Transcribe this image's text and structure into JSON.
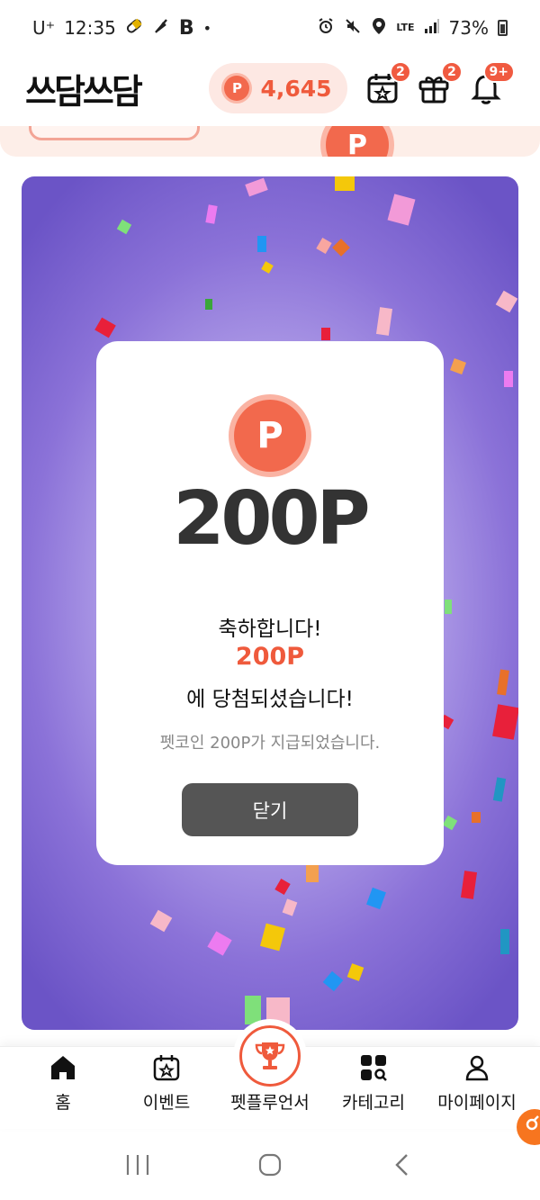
{
  "status_bar": {
    "carrier": "U⁺",
    "time": "12:35",
    "notif_b": "B",
    "dot": "•",
    "network": "LTE",
    "battery": "73%"
  },
  "header": {
    "logo": "쓰담쓰담",
    "points": "4,645",
    "coin_letter": "P",
    "badges": {
      "calendar": "2",
      "gift": "2",
      "bell": "9+"
    }
  },
  "modal": {
    "coin_letter": "P",
    "amount": "200P",
    "congrats": "축하합니다!",
    "won_amount": "200P",
    "won_text": "에 당첨되셨습니다!",
    "sub_text": "펫코인 200P가 지급되었습니다.",
    "close_label": "닫기"
  },
  "bottom_nav": {
    "items": [
      {
        "label": "홈",
        "icon": "home-icon"
      },
      {
        "label": "이벤트",
        "icon": "event-calendar-icon"
      },
      {
        "label": "펫플루언서",
        "icon": "trophy-icon"
      },
      {
        "label": "카테고리",
        "icon": "category-grid-icon"
      },
      {
        "label": "마이페이지",
        "icon": "profile-icon"
      }
    ]
  },
  "colors": {
    "accent": "#ef5a3c",
    "coin": "#f2694d",
    "button_dark": "#555555",
    "card_purple": "#8b72d8"
  }
}
